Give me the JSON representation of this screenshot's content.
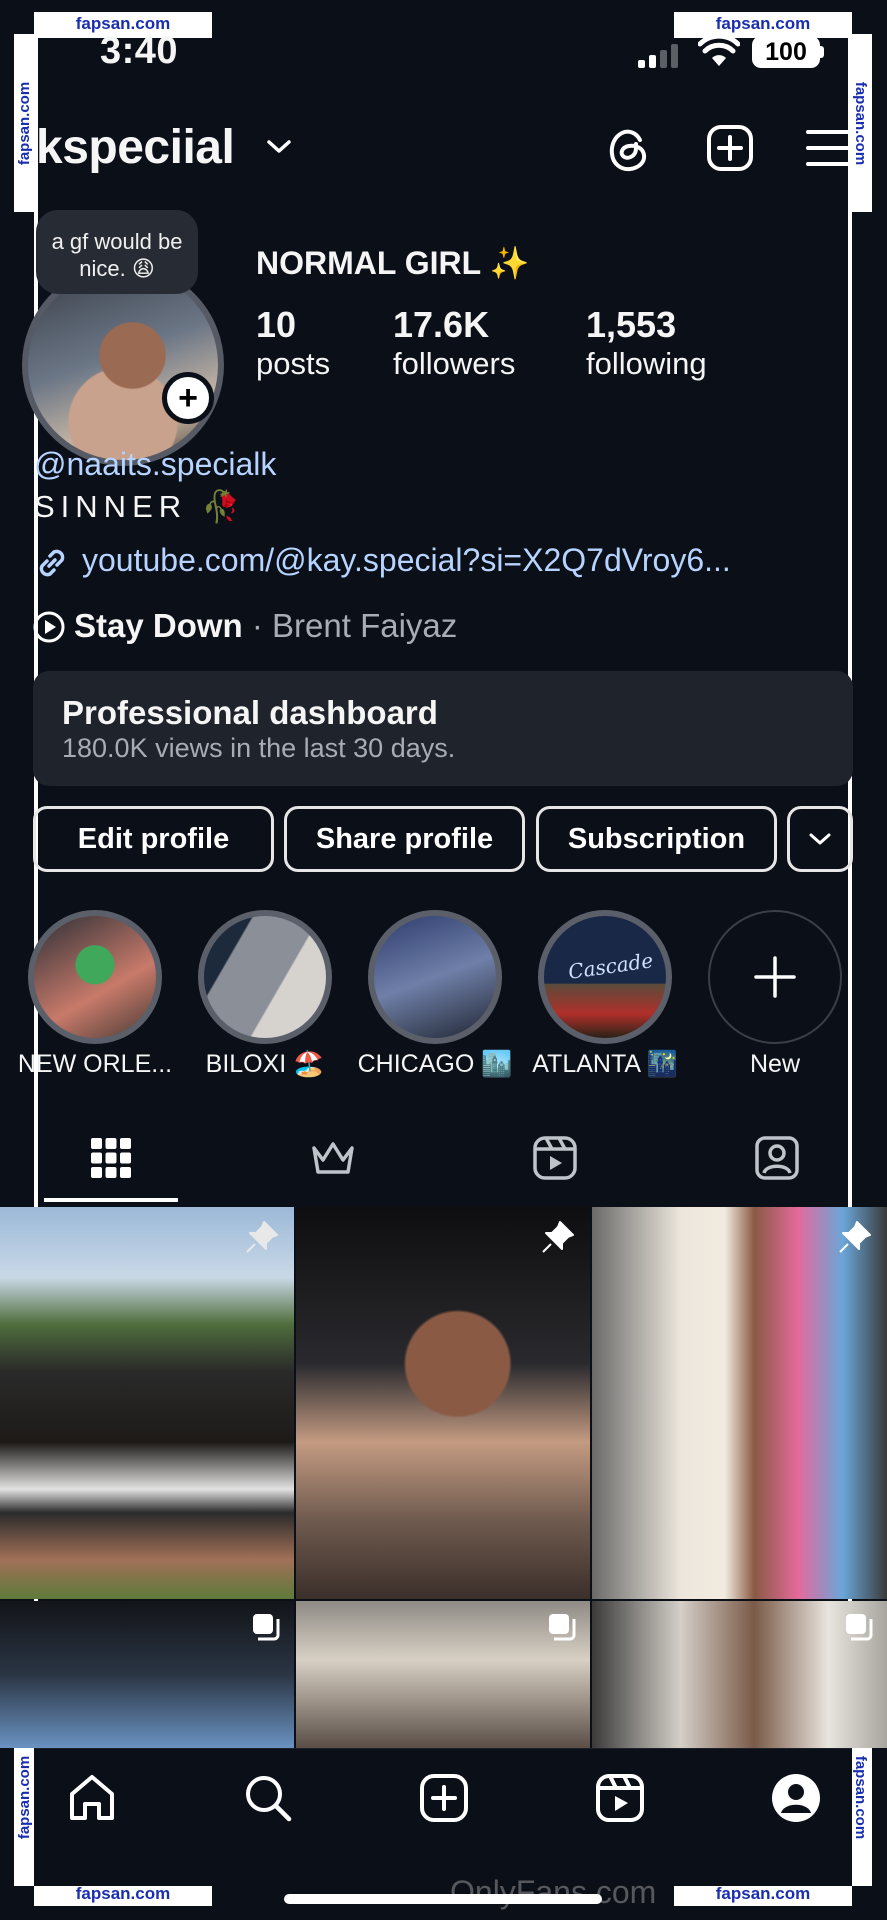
{
  "watermark": {
    "text": "fapsan.com",
    "overlay_text": "OnlyFans.com"
  },
  "status_bar": {
    "time": "3:40",
    "battery": "100"
  },
  "header": {
    "username": "kspeciial"
  },
  "profile": {
    "note": "a gf would be nice. 😩",
    "display_name": "NORMAL GIRL ✨",
    "stats": [
      {
        "value": "10",
        "label": "posts"
      },
      {
        "value": "17.6K",
        "label": "followers"
      },
      {
        "value": "1,553",
        "label": "following"
      }
    ],
    "mention": "@naaits.specialk",
    "bio": "SINNER 🥀",
    "link": "youtube.com/@kay.special?si=X2Q7dVroy6...",
    "music": {
      "title": "Stay Down",
      "separator": "·",
      "artist": "Brent Faiyaz"
    }
  },
  "dashboard": {
    "title": "Professional dashboard",
    "subtitle": "180.0K views in the last 30 days."
  },
  "actions": {
    "edit": "Edit profile",
    "share": "Share profile",
    "subscription": "Subscription"
  },
  "highlights": [
    {
      "label": "NEW ORLE..."
    },
    {
      "label": "BILOXI 🏖️"
    },
    {
      "label": "CHICAGO 🏙️"
    },
    {
      "label": "ATLANTA 🌃"
    },
    {
      "label": "New"
    }
  ],
  "highlight_overlay_text": "Cascade",
  "colors": {
    "background": "#0b0f18",
    "link": "#b6d4ff",
    "card": "#1e232c",
    "watermark_text": "#1a2fb0"
  },
  "icons": {
    "header": [
      "chevron-down-icon",
      "threads-icon",
      "plus-square-icon",
      "menu-icon"
    ],
    "tabs": [
      "grid-icon",
      "crown-icon",
      "reels-icon",
      "tagged-icon"
    ],
    "nav": [
      "home-icon",
      "search-icon",
      "create-icon",
      "reels-icon",
      "profile-icon"
    ]
  }
}
